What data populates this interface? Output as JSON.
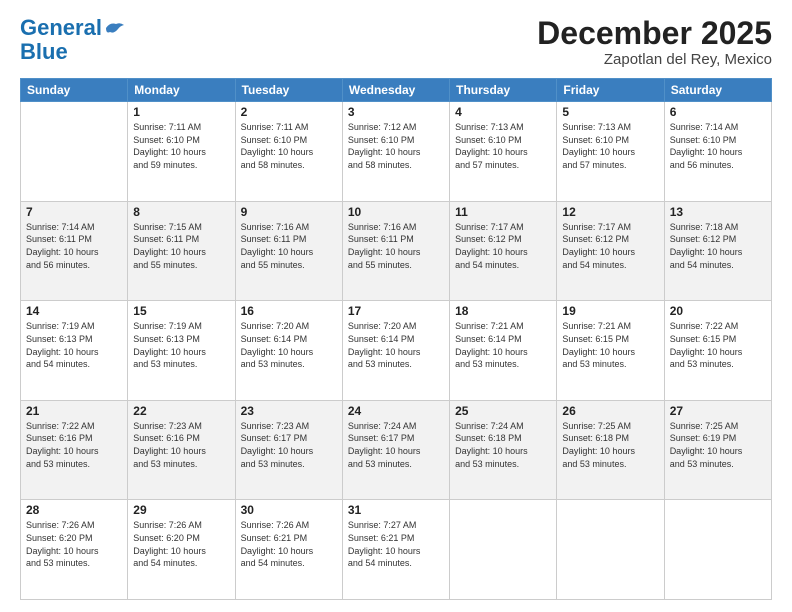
{
  "header": {
    "logo_line1": "General",
    "logo_line2": "Blue",
    "title": "December 2025",
    "subtitle": "Zapotlan del Rey, Mexico"
  },
  "calendar": {
    "days_of_week": [
      "Sunday",
      "Monday",
      "Tuesday",
      "Wednesday",
      "Thursday",
      "Friday",
      "Saturday"
    ],
    "weeks": [
      [
        {
          "day": "",
          "lines": []
        },
        {
          "day": "1",
          "lines": [
            "Sunrise: 7:11 AM",
            "Sunset: 6:10 PM",
            "Daylight: 10 hours",
            "and 59 minutes."
          ]
        },
        {
          "day": "2",
          "lines": [
            "Sunrise: 7:11 AM",
            "Sunset: 6:10 PM",
            "Daylight: 10 hours",
            "and 58 minutes."
          ]
        },
        {
          "day": "3",
          "lines": [
            "Sunrise: 7:12 AM",
            "Sunset: 6:10 PM",
            "Daylight: 10 hours",
            "and 58 minutes."
          ]
        },
        {
          "day": "4",
          "lines": [
            "Sunrise: 7:13 AM",
            "Sunset: 6:10 PM",
            "Daylight: 10 hours",
            "and 57 minutes."
          ]
        },
        {
          "day": "5",
          "lines": [
            "Sunrise: 7:13 AM",
            "Sunset: 6:10 PM",
            "Daylight: 10 hours",
            "and 57 minutes."
          ]
        },
        {
          "day": "6",
          "lines": [
            "Sunrise: 7:14 AM",
            "Sunset: 6:10 PM",
            "Daylight: 10 hours",
            "and 56 minutes."
          ]
        }
      ],
      [
        {
          "day": "7",
          "lines": [
            "Sunrise: 7:14 AM",
            "Sunset: 6:11 PM",
            "Daylight: 10 hours",
            "and 56 minutes."
          ]
        },
        {
          "day": "8",
          "lines": [
            "Sunrise: 7:15 AM",
            "Sunset: 6:11 PM",
            "Daylight: 10 hours",
            "and 55 minutes."
          ]
        },
        {
          "day": "9",
          "lines": [
            "Sunrise: 7:16 AM",
            "Sunset: 6:11 PM",
            "Daylight: 10 hours",
            "and 55 minutes."
          ]
        },
        {
          "day": "10",
          "lines": [
            "Sunrise: 7:16 AM",
            "Sunset: 6:11 PM",
            "Daylight: 10 hours",
            "and 55 minutes."
          ]
        },
        {
          "day": "11",
          "lines": [
            "Sunrise: 7:17 AM",
            "Sunset: 6:12 PM",
            "Daylight: 10 hours",
            "and 54 minutes."
          ]
        },
        {
          "day": "12",
          "lines": [
            "Sunrise: 7:17 AM",
            "Sunset: 6:12 PM",
            "Daylight: 10 hours",
            "and 54 minutes."
          ]
        },
        {
          "day": "13",
          "lines": [
            "Sunrise: 7:18 AM",
            "Sunset: 6:12 PM",
            "Daylight: 10 hours",
            "and 54 minutes."
          ]
        }
      ],
      [
        {
          "day": "14",
          "lines": [
            "Sunrise: 7:19 AM",
            "Sunset: 6:13 PM",
            "Daylight: 10 hours",
            "and 54 minutes."
          ]
        },
        {
          "day": "15",
          "lines": [
            "Sunrise: 7:19 AM",
            "Sunset: 6:13 PM",
            "Daylight: 10 hours",
            "and 53 minutes."
          ]
        },
        {
          "day": "16",
          "lines": [
            "Sunrise: 7:20 AM",
            "Sunset: 6:14 PM",
            "Daylight: 10 hours",
            "and 53 minutes."
          ]
        },
        {
          "day": "17",
          "lines": [
            "Sunrise: 7:20 AM",
            "Sunset: 6:14 PM",
            "Daylight: 10 hours",
            "and 53 minutes."
          ]
        },
        {
          "day": "18",
          "lines": [
            "Sunrise: 7:21 AM",
            "Sunset: 6:14 PM",
            "Daylight: 10 hours",
            "and 53 minutes."
          ]
        },
        {
          "day": "19",
          "lines": [
            "Sunrise: 7:21 AM",
            "Sunset: 6:15 PM",
            "Daylight: 10 hours",
            "and 53 minutes."
          ]
        },
        {
          "day": "20",
          "lines": [
            "Sunrise: 7:22 AM",
            "Sunset: 6:15 PM",
            "Daylight: 10 hours",
            "and 53 minutes."
          ]
        }
      ],
      [
        {
          "day": "21",
          "lines": [
            "Sunrise: 7:22 AM",
            "Sunset: 6:16 PM",
            "Daylight: 10 hours",
            "and 53 minutes."
          ]
        },
        {
          "day": "22",
          "lines": [
            "Sunrise: 7:23 AM",
            "Sunset: 6:16 PM",
            "Daylight: 10 hours",
            "and 53 minutes."
          ]
        },
        {
          "day": "23",
          "lines": [
            "Sunrise: 7:23 AM",
            "Sunset: 6:17 PM",
            "Daylight: 10 hours",
            "and 53 minutes."
          ]
        },
        {
          "day": "24",
          "lines": [
            "Sunrise: 7:24 AM",
            "Sunset: 6:17 PM",
            "Daylight: 10 hours",
            "and 53 minutes."
          ]
        },
        {
          "day": "25",
          "lines": [
            "Sunrise: 7:24 AM",
            "Sunset: 6:18 PM",
            "Daylight: 10 hours",
            "and 53 minutes."
          ]
        },
        {
          "day": "26",
          "lines": [
            "Sunrise: 7:25 AM",
            "Sunset: 6:18 PM",
            "Daylight: 10 hours",
            "and 53 minutes."
          ]
        },
        {
          "day": "27",
          "lines": [
            "Sunrise: 7:25 AM",
            "Sunset: 6:19 PM",
            "Daylight: 10 hours",
            "and 53 minutes."
          ]
        }
      ],
      [
        {
          "day": "28",
          "lines": [
            "Sunrise: 7:26 AM",
            "Sunset: 6:20 PM",
            "Daylight: 10 hours",
            "and 53 minutes."
          ]
        },
        {
          "day": "29",
          "lines": [
            "Sunrise: 7:26 AM",
            "Sunset: 6:20 PM",
            "Daylight: 10 hours",
            "and 54 minutes."
          ]
        },
        {
          "day": "30",
          "lines": [
            "Sunrise: 7:26 AM",
            "Sunset: 6:21 PM",
            "Daylight: 10 hours",
            "and 54 minutes."
          ]
        },
        {
          "day": "31",
          "lines": [
            "Sunrise: 7:27 AM",
            "Sunset: 6:21 PM",
            "Daylight: 10 hours",
            "and 54 minutes."
          ]
        },
        {
          "day": "",
          "lines": []
        },
        {
          "day": "",
          "lines": []
        },
        {
          "day": "",
          "lines": []
        }
      ]
    ]
  }
}
